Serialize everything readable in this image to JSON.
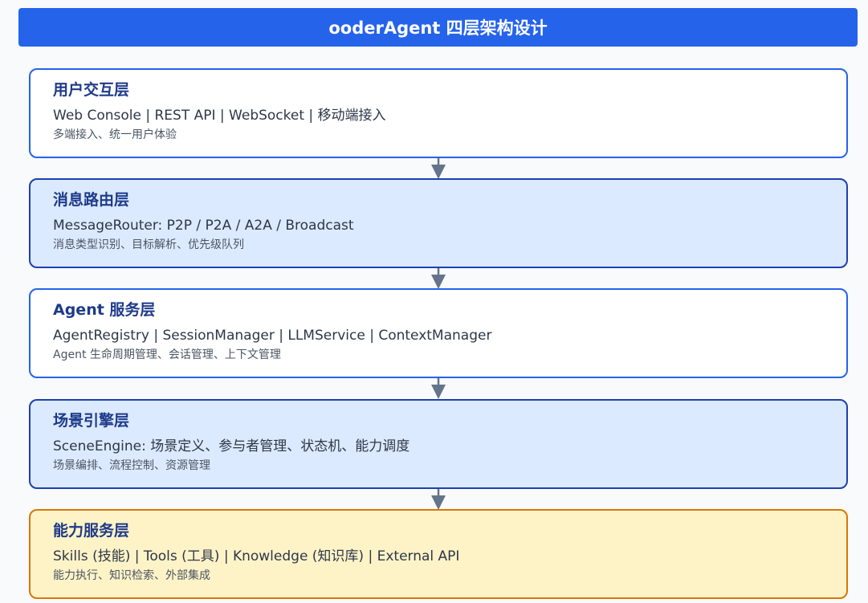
{
  "header": {
    "title": "ooderAgent 四层架构设计"
  },
  "colors": {
    "header_bg": "#2563eb",
    "white_layer_border": "#2563eb",
    "blue_layer_border": "#1e40af",
    "blue_layer_bg": "#dbeafe",
    "yellow_layer_border": "#d97706",
    "yellow_layer_bg": "#fef3c7",
    "title_text": "#1e3a8a",
    "arrow": "#64748b"
  },
  "layers": [
    {
      "title": "用户交互层",
      "components": "Web Console | REST API | WebSocket | 移动端接入",
      "description": "多端接入、统一用户体验",
      "style": "white"
    },
    {
      "title": "消息路由层",
      "components": "MessageRouter: P2P / P2A / A2A / Broadcast",
      "description": "消息类型识别、目标解析、优先级队列",
      "style": "blue"
    },
    {
      "title": "Agent 服务层",
      "components": "AgentRegistry | SessionManager | LLMService | ContextManager",
      "description": "Agent 生命周期管理、会话管理、上下文管理",
      "style": "white"
    },
    {
      "title": "场景引擎层",
      "components": "SceneEngine: 场景定义、参与者管理、状态机、能力调度",
      "description": "场景编排、流程控制、资源管理",
      "style": "blue"
    },
    {
      "title": "能力服务层",
      "components": "Skills (技能) | Tools (工具) | Knowledge (知识库) | External API",
      "description": "能力执行、知识检索、外部集成",
      "style": "yellow"
    }
  ]
}
